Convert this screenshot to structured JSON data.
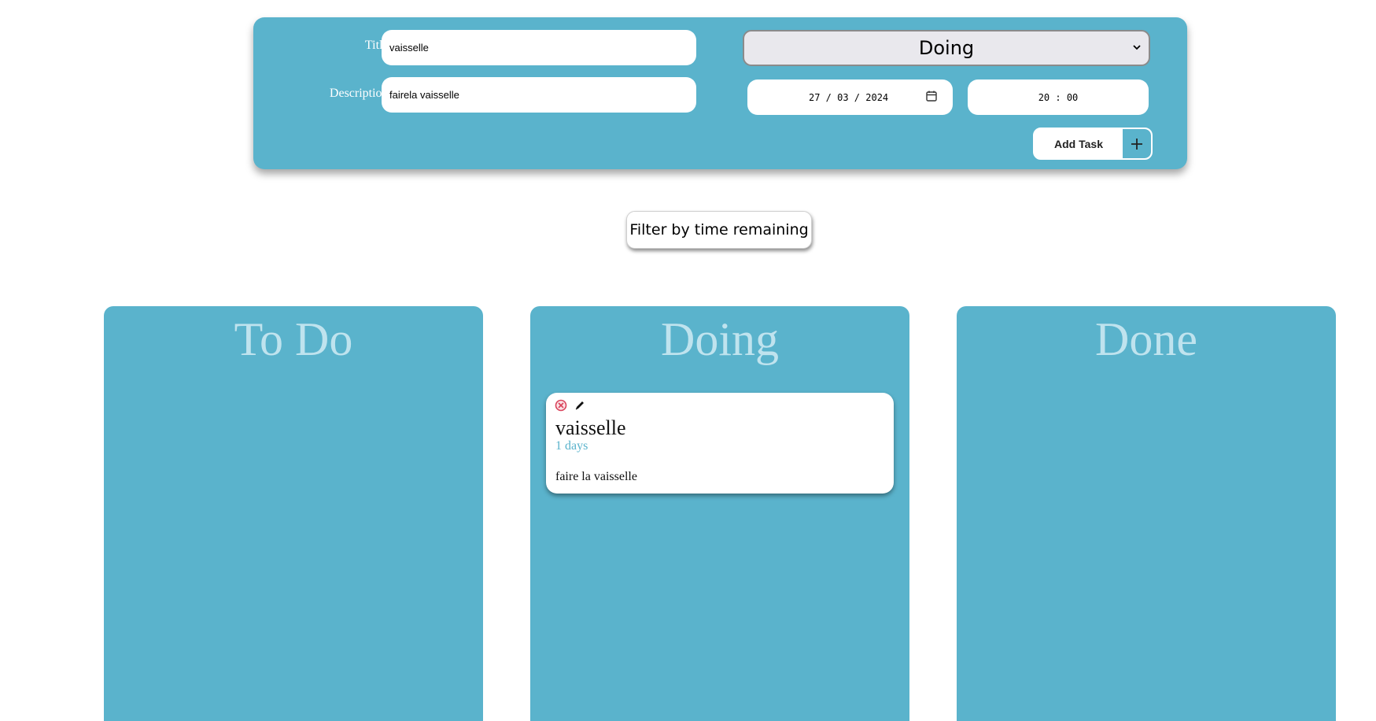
{
  "form": {
    "title_label": "Title :",
    "title_value": "vaisselle",
    "description_label": "Description :",
    "description_value": "fairela vaisselle",
    "status_selected": "Doing",
    "date_value": "27 / 03 / 2024",
    "time_value": "20 : 00",
    "add_button_label": "Add Task"
  },
  "filter": {
    "label": "Filter by time remaining"
  },
  "columns": [
    {
      "title": "To Do",
      "tasks": []
    },
    {
      "title": "Doing",
      "tasks": [
        {
          "title": "vaisselle",
          "remaining": "1 days",
          "description": "faire la vaisselle",
          "icons": [
            "delete-icon",
            "edit-icon"
          ]
        }
      ]
    },
    {
      "title": "Done",
      "tasks": []
    }
  ],
  "colors": {
    "accent": "#5ab3cc",
    "column_title": "#bfe3ee",
    "delete_icon": "#d9435b"
  }
}
